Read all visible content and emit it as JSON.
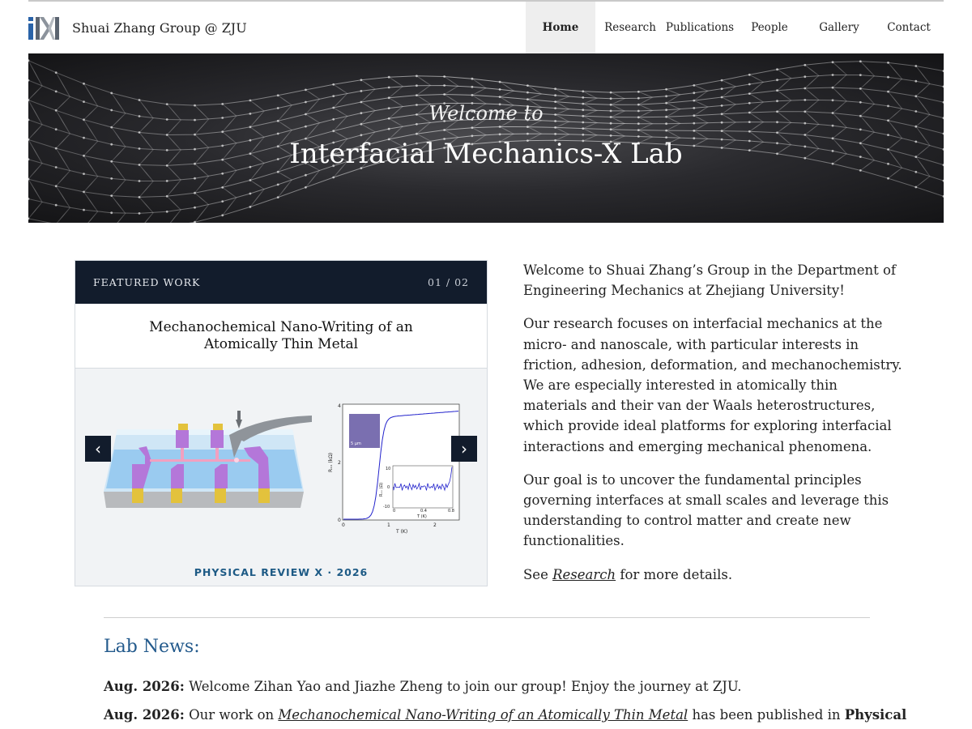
{
  "nav": {
    "brand": "Shuai Zhang Group @ ZJU",
    "items": [
      {
        "label": "Home",
        "active": true
      },
      {
        "label": "Research"
      },
      {
        "label": "Publications"
      },
      {
        "label": "People"
      },
      {
        "label": "Gallery"
      },
      {
        "label": "Contact"
      }
    ]
  },
  "hero": {
    "subtitle": "Welcome to",
    "title": "Interfacial Mechanics-X Lab"
  },
  "featured": {
    "kicker": "FEATURED WORK",
    "counter": "01 / 02",
    "title": "Mechanochemical Nano-Writing of an Atomically Thin Metal",
    "journal": "PHYSICAL REVIEW X · 2026",
    "prev_arrow": "‹",
    "next_arrow": "›",
    "plot_labels": {
      "y_ticks": [
        "0",
        "2",
        "4"
      ],
      "x_ticks": [
        "0",
        "1",
        "2"
      ],
      "y_axis": "Rₓₓ (kΩ)",
      "x_axis": "T (K)",
      "inset_x_ticks": [
        "0",
        "0.4",
        "0.8"
      ],
      "inset_y_ticks": [
        "10",
        "0",
        "-10"
      ],
      "inset_x_axis": "T (K)",
      "inset_y_axis": "Rₓₓ (Ω)",
      "scale_bar": "5 μm"
    },
    "colors": {
      "curve": "#2222cc",
      "header_bg": "#121c2c",
      "journal": "#1d5a85"
    }
  },
  "intro": {
    "p1": "Welcome to Shuai Zhang’s Group in the Department of Engineering Mechanics at Zhejiang University!",
    "p2": "Our research focuses on interfacial mechanics at the micro- and nanoscale, with particular interests in friction, adhesion, deformation, and mechanochemistry. We are especially interested in atomically thin materials and their van der Waals heterostructures, which provide ideal platforms for exploring interfacial interactions and emerging mechanical phenomena.",
    "p3": "Our goal is to uncover the fundamental principles governing interfaces at small scales and leverage this understanding to control matter and create new functionalities.",
    "see_prefix": "See",
    "see_link": "Research",
    "see_suffix": "for more details."
  },
  "news": {
    "heading": "Lab News:",
    "items": [
      {
        "date": "Aug. 2026:",
        "text": "Welcome Zihan Yao and Jiazhe Zheng to join our group! Enjoy the journey at ZJU."
      },
      {
        "date": "Aug. 2026:",
        "text_prefix": "Our work on",
        "link": "Mechanochemical Nano-Writing of an Atomically Thin Metal",
        "text_middle": "has been published in",
        "bold_tail": "Physical"
      }
    ]
  }
}
